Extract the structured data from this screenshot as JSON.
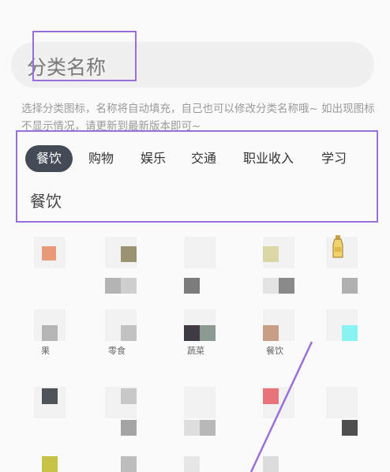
{
  "name_input": {
    "placeholder": "分类名称"
  },
  "hint": "选择分类图标，名称将自动填充，自己也可以修改分类名称哦~ 如出现图标不显示情况，请更新到最新版本即可~",
  "tabs": [
    {
      "label": "餐饮",
      "active": true
    },
    {
      "label": "购物",
      "active": false
    },
    {
      "label": "娱乐",
      "active": false
    },
    {
      "label": "交通",
      "active": false
    },
    {
      "label": "职业收入",
      "active": false
    },
    {
      "label": "学习",
      "active": false
    }
  ],
  "selected_category": "餐饮",
  "icon_grid": {
    "partial_labels": [
      "果",
      "零食",
      "蔬菜",
      "餐饮"
    ],
    "highlight_color": "#9b6fd9",
    "active_tab_color": "#444a56"
  }
}
